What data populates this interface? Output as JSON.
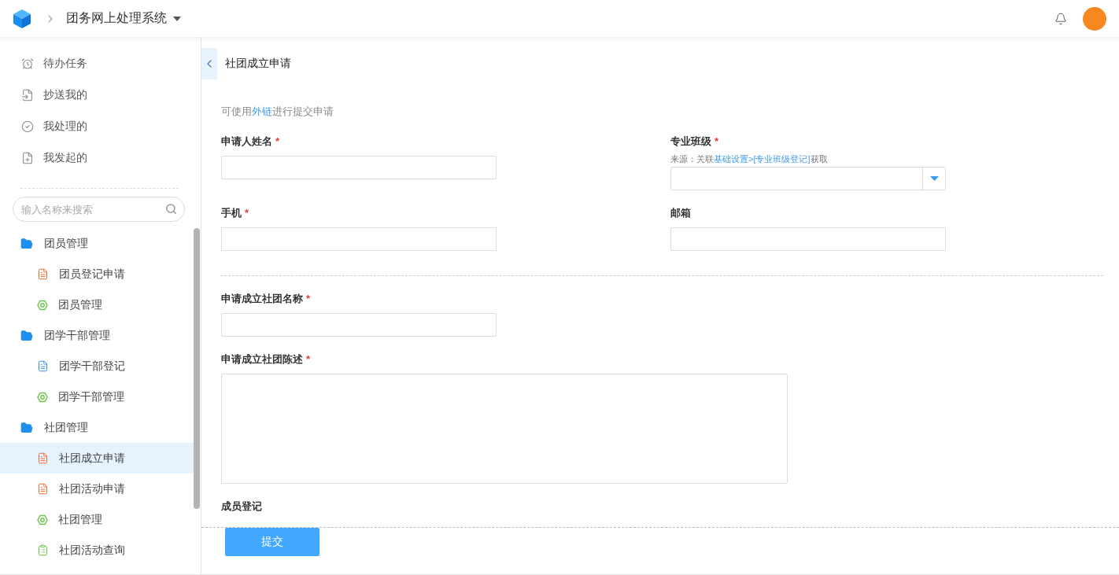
{
  "header": {
    "title": "团务网上处理系统"
  },
  "sidebar": {
    "quick_items": [
      {
        "kind": "pending",
        "label": "待办任务"
      },
      {
        "kind": "cc",
        "label": "抄送我的"
      },
      {
        "kind": "handled",
        "label": "我处理的"
      },
      {
        "kind": "started",
        "label": "我发起的"
      }
    ],
    "search": {
      "placeholder": "输入名称来搜索"
    },
    "tree": [
      {
        "label": "团员管理",
        "expanded": true,
        "children": [
          {
            "kind": "application",
            "label": "团员登记申请",
            "selected": false
          },
          {
            "kind": "manage",
            "label": "团员管理",
            "selected": false
          }
        ]
      },
      {
        "label": "团学干部管理",
        "expanded": true,
        "children": [
          {
            "kind": "record",
            "label": "团学干部登记",
            "selected": false
          },
          {
            "kind": "manage",
            "label": "团学干部管理",
            "selected": false
          }
        ]
      },
      {
        "label": "社团管理",
        "expanded": true,
        "children": [
          {
            "kind": "application",
            "label": "社团成立申请",
            "selected": true
          },
          {
            "kind": "application",
            "label": "社团活动申请",
            "selected": false
          },
          {
            "kind": "manage",
            "label": "社团管理",
            "selected": false
          },
          {
            "kind": "query",
            "label": "社团活动查询",
            "selected": false
          }
        ]
      }
    ]
  },
  "page": {
    "title": "社团成立申请",
    "hint": {
      "prefix": "可使用",
      "link": "外链",
      "suffix": "进行提交申请"
    },
    "sections": [
      {
        "kind": "two-column",
        "fields": [
          {
            "kind": "text",
            "label": "申请人姓名",
            "mark": "*"
          },
          {
            "kind": "select",
            "label": "专业班级",
            "mark": "*",
            "note": {
              "prefix": "来源：关联",
              "link": "基础设置>[专业班级登记]",
              "suffix": "获取"
            }
          },
          {
            "kind": "text",
            "label": "手机",
            "mark": "*"
          },
          {
            "kind": "text",
            "label": "邮箱"
          }
        ]
      },
      {
        "kind": "single-column",
        "fields": [
          {
            "kind": "text",
            "label": "申请成立社团名称",
            "mark": "*"
          },
          {
            "kind": "textarea",
            "label": "申请成立社团陈述",
            "mark": "*"
          },
          {
            "kind": "heading",
            "label": "成员登记"
          }
        ]
      }
    ],
    "submit": "提交"
  }
}
